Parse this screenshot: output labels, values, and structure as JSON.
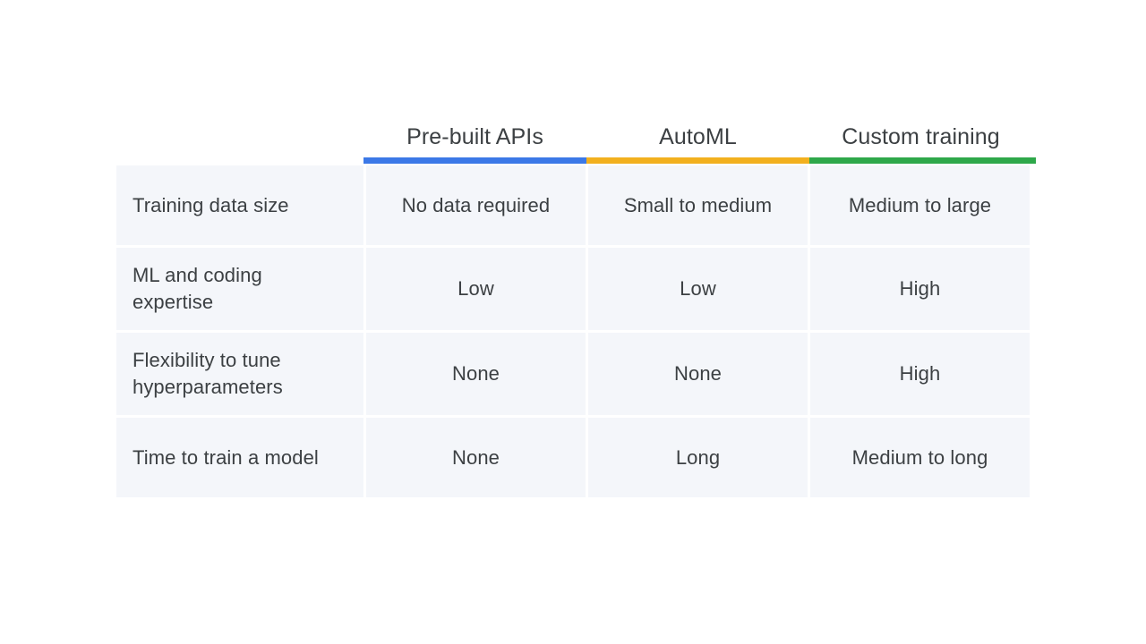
{
  "slide": {
    "background_color": "#ffffff",
    "text_color": "#3c4043",
    "cell_background_color": "#f4f6fa"
  },
  "table": {
    "row_header_column_label": "",
    "columns": [
      {
        "label": "Pre-built APIs",
        "accent_color": "#3b78e7"
      },
      {
        "label": "AutoML",
        "accent_color": "#f2b01e"
      },
      {
        "label": "Custom training",
        "accent_color": "#2ea84a"
      }
    ],
    "rows": [
      {
        "label": "Training data size",
        "values": [
          "No data required",
          "Small to medium",
          "Medium to large"
        ]
      },
      {
        "label": "ML and coding expertise",
        "values": [
          "Low",
          "Low",
          "High"
        ]
      },
      {
        "label": "Flexibility to tune hyperparameters",
        "values": [
          "None",
          "None",
          "High"
        ]
      },
      {
        "label": "Time to train a model",
        "values": [
          "None",
          "Long",
          "Medium to long"
        ]
      }
    ]
  }
}
